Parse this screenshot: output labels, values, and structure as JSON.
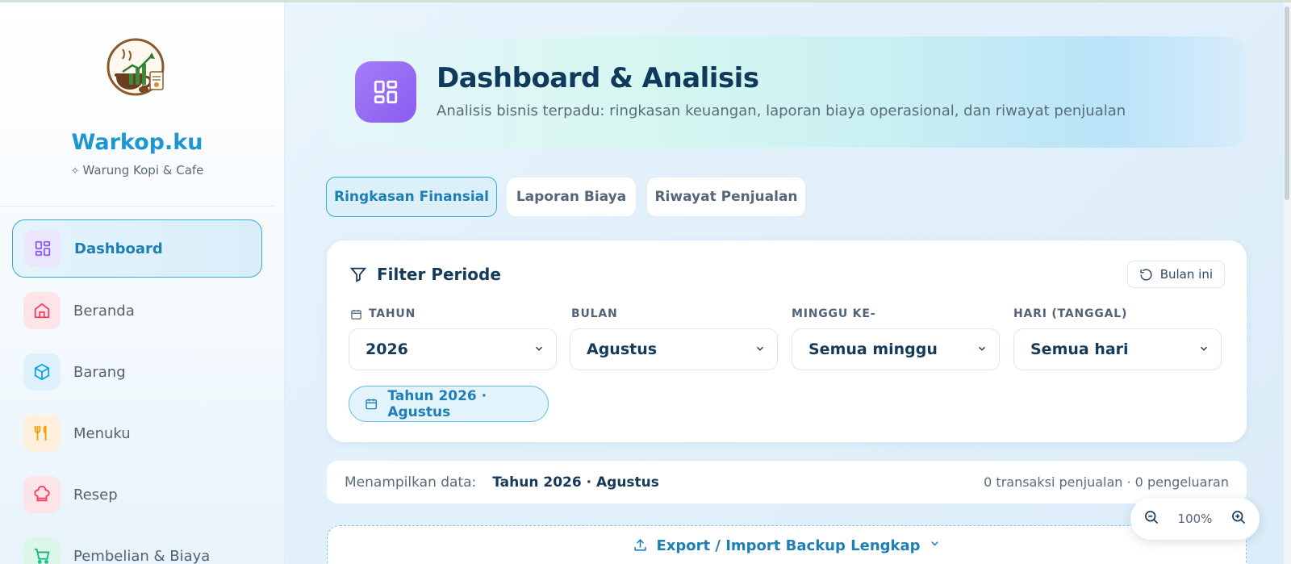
{
  "brand": {
    "name": "Warkop.ku",
    "subtitle": "Warung Kopi & Cafe"
  },
  "sidebar": {
    "items": [
      {
        "label": "Dashboard",
        "icon": "dashboard-icon",
        "active": true,
        "color": "#8b5cf6"
      },
      {
        "label": "Beranda",
        "icon": "home-icon",
        "color": "#f43f5e"
      },
      {
        "label": "Barang",
        "icon": "box-icon",
        "color": "#0ea5e9"
      },
      {
        "label": "Menuku",
        "icon": "utensils-icon",
        "color": "#f59e0b"
      },
      {
        "label": "Resep",
        "icon": "chef-hat-icon",
        "color": "#f43f5e"
      },
      {
        "label": "Pembelian & Biaya",
        "icon": "cart-icon",
        "color": "#10b981"
      }
    ]
  },
  "header": {
    "title": "Dashboard & Analisis",
    "subtitle": "Analisis bisnis terpadu: ringkasan keuangan, laporan biaya operasional, dan riwayat penjualan"
  },
  "tabs": [
    {
      "label": "Ringkasan Finansial",
      "active": true
    },
    {
      "label": "Laporan Biaya"
    },
    {
      "label": "Riwayat Penjualan"
    }
  ],
  "filter": {
    "title": "Filter Periode",
    "reset_label": "Bulan ini",
    "fields": [
      {
        "label": "TAHUN",
        "value": "2026"
      },
      {
        "label": "BULAN",
        "value": "Agustus"
      },
      {
        "label": "MINGGU KE-",
        "value": "Semua minggu"
      },
      {
        "label": "HARI (TANGGAL)",
        "value": "Semua hari"
      }
    ],
    "chip": "Tahun 2026 · Agustus"
  },
  "info": {
    "label": "Menampilkan data:",
    "value": "Tahun 2026 · Agustus",
    "summary": "0 transaksi penjualan · 0 pengeluaran"
  },
  "export": {
    "label": "Export / Import Backup Lengkap"
  },
  "zoom": {
    "value": "100%"
  },
  "colors": {
    "accent": "#1e7fb5",
    "brand": "#1d97cf",
    "header_icon": "#8b5cf0"
  }
}
